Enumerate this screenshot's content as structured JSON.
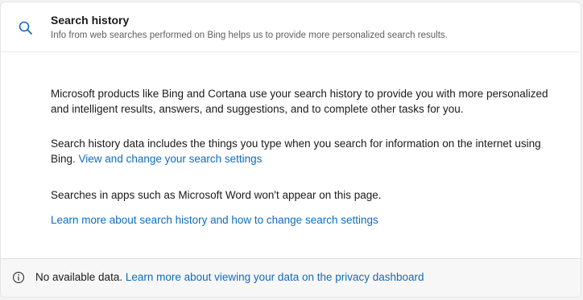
{
  "header": {
    "icon": "search-icon",
    "title": "Search history",
    "subtitle": "Info from web searches performed on Bing helps us to provide more personalized search results."
  },
  "body": {
    "paragraph1": "Microsoft products like Bing and Cortana use your search history to provide you with more personalized and intelligent results, answers, and suggestions, and to complete other tasks for you.",
    "paragraph2_text": "Search history data includes the things you type when you search for information on the internet using Bing. ",
    "paragraph2_link": "View and change your search settings",
    "paragraph3": "Searches in apps such as Microsoft Word won't appear on this page.",
    "learn_more_link": "Learn more about search history and how to change search settings"
  },
  "footer": {
    "icon": "info-icon",
    "text": "No available data. ",
    "link": "Learn more about viewing your data on the privacy dashboard"
  },
  "colors": {
    "link": "#0f6cbd",
    "icon_accent": "#0f6cbd"
  }
}
